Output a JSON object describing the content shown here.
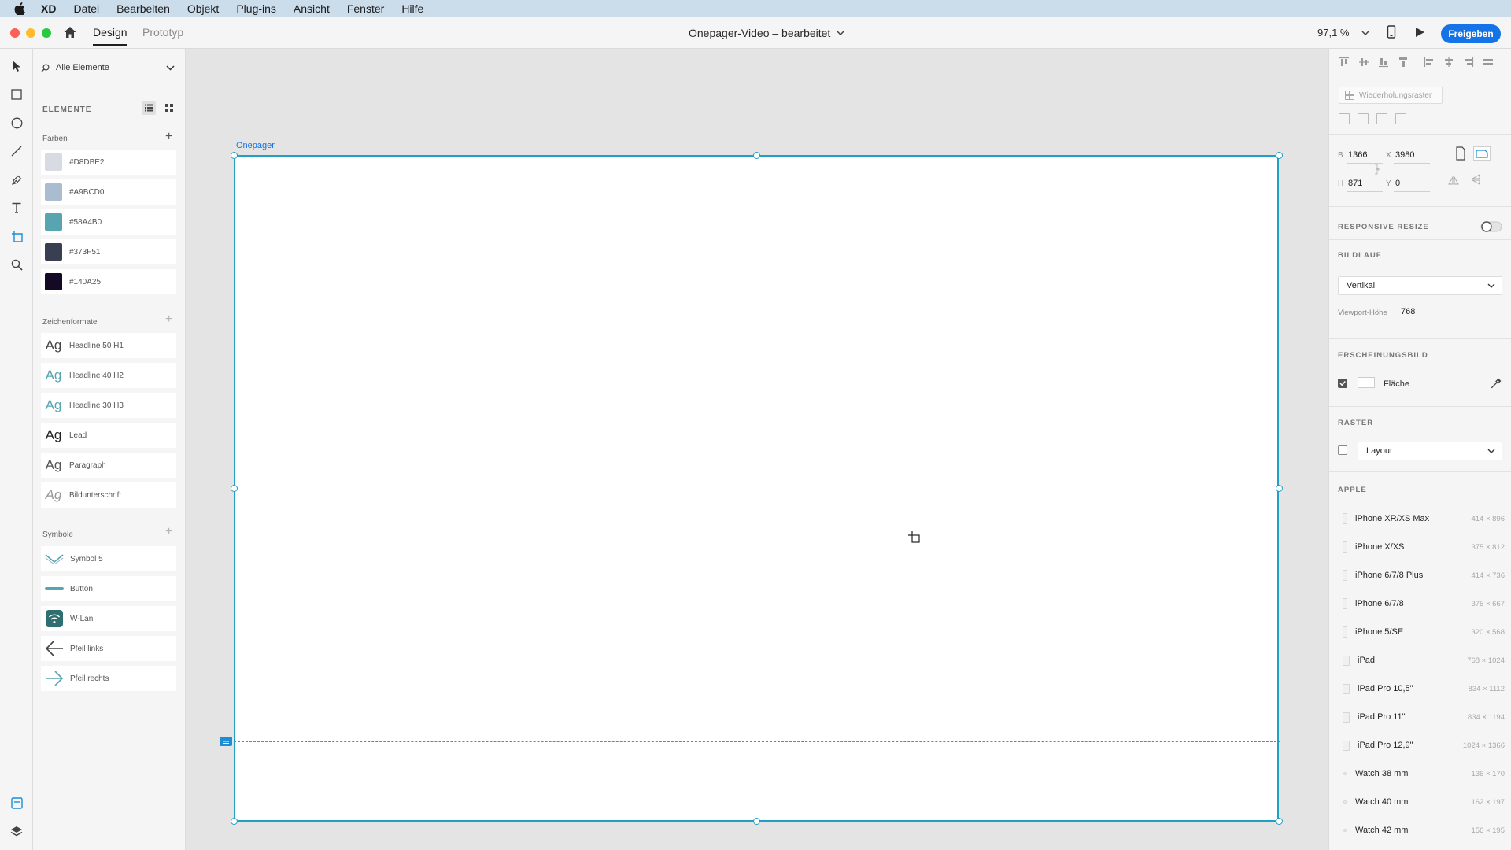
{
  "menubar": {
    "app": "XD",
    "items": [
      "Datei",
      "Bearbeiten",
      "Objekt",
      "Plug-ins",
      "Ansicht",
      "Fenster",
      "Hilfe"
    ]
  },
  "titlebar": {
    "tabs": [
      "Design",
      "Prototyp"
    ],
    "active_tab": "Design",
    "document_title": "Onepager-Video – bearbeitet",
    "zoom": "97,1 %",
    "share_label": "Freigeben"
  },
  "assets": {
    "filter_label": "Alle Elemente",
    "section_title": "ELEMENTE",
    "colors_title": "Farben",
    "colors": [
      {
        "hex": "#D8DBE2",
        "label": "#D8DBE2"
      },
      {
        "hex": "#A9BCD0",
        "label": "#A9BCD0"
      },
      {
        "hex": "#58A4B0",
        "label": "#58A4B0"
      },
      {
        "hex": "#373F51",
        "label": "#373F51"
      },
      {
        "hex": "#140A25",
        "label": "#140A25"
      }
    ],
    "char_styles_title": "Zeichenformate",
    "char_styles": [
      {
        "sample": "Ag",
        "label": "Headline 50 H1",
        "color": "#444444"
      },
      {
        "sample": "Ag",
        "label": "Headline 40 H2",
        "color": "#58A4B0"
      },
      {
        "sample": "Ag",
        "label": "Headline 30 H3",
        "color": "#58A4B0"
      },
      {
        "sample": "Ag",
        "label": "Lead",
        "color": "#222222"
      },
      {
        "sample": "Ag",
        "label": "Paragraph",
        "color": "#555555"
      },
      {
        "sample": "Ag",
        "label": "Bildunterschrift",
        "color": "#999999"
      }
    ],
    "symbols_title": "Symbole",
    "symbols": [
      {
        "icon": "chevron-symbol-icon",
        "label": "Symbol 5"
      },
      {
        "icon": "button-symbol-icon",
        "label": "Button"
      },
      {
        "icon": "wifi-symbol-icon",
        "label": "W-Lan"
      },
      {
        "icon": "arrow-left-icon",
        "label": "Pfeil links"
      },
      {
        "icon": "arrow-right-icon",
        "label": "Pfeil rechts"
      }
    ]
  },
  "canvas": {
    "artboard_name": "Onepager"
  },
  "inspector": {
    "repeat_grid_label": "Wiederholungsraster",
    "width_label": "B",
    "width_value": "1366",
    "height_label": "H",
    "height_value": "871",
    "x_label": "X",
    "x_value": "3980",
    "y_label": "Y",
    "y_value": "0",
    "responsive_resize": "RESPONSIVE RESIZE",
    "scrolling_title": "BILDLAUF",
    "scrolling_value": "Vertikal",
    "viewport_label": "Viewport-Höhe",
    "viewport_value": "768",
    "appearance_title": "ERSCHEINUNGSBILD",
    "fill_label": "Fläche",
    "grid_title": "RASTER",
    "grid_value": "Layout",
    "apple_title": "APPLE",
    "devices": [
      {
        "name": "iPhone XR/XS Max",
        "size": "414 × 896"
      },
      {
        "name": "iPhone X/XS",
        "size": "375 × 812"
      },
      {
        "name": "iPhone 6/7/8 Plus",
        "size": "414 × 736"
      },
      {
        "name": "iPhone 6/7/8",
        "size": "375 × 667"
      },
      {
        "name": "iPhone 5/SE",
        "size": "320 × 568"
      },
      {
        "name": "iPad",
        "size": "768 × 1024"
      },
      {
        "name": "iPad Pro 10,5\"",
        "size": "834 × 1112"
      },
      {
        "name": "iPad Pro 11\"",
        "size": "834 × 1194"
      },
      {
        "name": "iPad Pro 12,9\"",
        "size": "1024 × 1366"
      },
      {
        "name": "Watch 38 mm",
        "size": "136 × 170"
      },
      {
        "name": "Watch 40 mm",
        "size": "162 × 197"
      },
      {
        "name": "Watch 42 mm",
        "size": "156 × 195"
      }
    ]
  }
}
